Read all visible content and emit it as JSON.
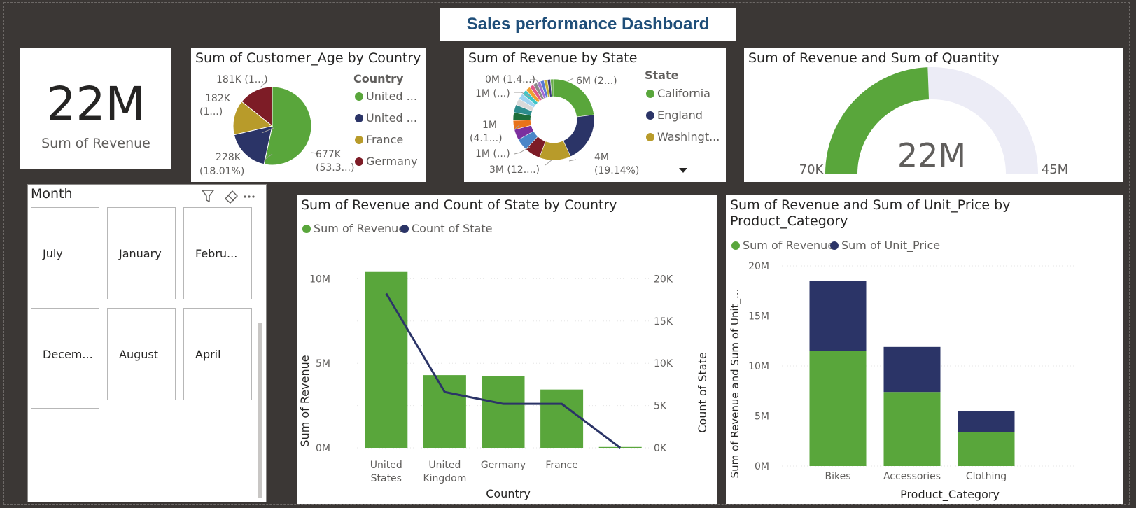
{
  "dashboard": {
    "title": "Sales performance Dashboard"
  },
  "colors": {
    "green": "#59a63b",
    "navy": "#2b3467",
    "gold": "#b89b2a",
    "maroon": "#7d1c26",
    "lavender": "#ececf6"
  },
  "kpi": {
    "value": "22M",
    "label": "Sum of Revenue"
  },
  "age_pie": {
    "title": "Sum of Customer_Age by Country",
    "legend_title": "Country",
    "legend": [
      {
        "label": "United ...",
        "color": "#59a63b"
      },
      {
        "label": "United ...",
        "color": "#2b3467"
      },
      {
        "label": "France",
        "color": "#b89b2a"
      },
      {
        "label": "Germany",
        "color": "#7d1c26"
      }
    ],
    "labels": {
      "green_a": "677K",
      "green_b": "(53.3...)",
      "navy_a": "228K",
      "navy_b": "(18.01%)",
      "gold_a": "182K",
      "gold_b": "(1...)",
      "maroon_a": "181K (1...)"
    }
  },
  "state_donut": {
    "title": "Sum of Revenue by State",
    "legend_title": "State",
    "legend": [
      {
        "label": "California",
        "color": "#59a63b"
      },
      {
        "label": "England",
        "color": "#2b3467"
      },
      {
        "label": "Washingt...",
        "color": "#b89b2a"
      }
    ],
    "labels": {
      "l1": "0M (1.4...)",
      "l2": "1M (...)",
      "l3a": "1M",
      "l3b": "(4.1...)",
      "l4": "1M (...)",
      "l5": "3M (12....)",
      "r1": "6M (2...)",
      "r2a": "4M",
      "r2b": "(19.14%)"
    },
    "more_icon": "caret-down-icon"
  },
  "gauge": {
    "title": "Sum of Revenue and Sum of Quantity",
    "value_label": "22M",
    "min_label": "70K",
    "max_label": "45M",
    "value": 22000000,
    "min": 70000,
    "max": 45000000
  },
  "slicer": {
    "header": "Month",
    "icons": [
      "filter-icon",
      "eraser-icon",
      "more-options-icon"
    ],
    "tiles": [
      "July",
      "January",
      "Febru...",
      "Decem...",
      "August",
      "April",
      ""
    ]
  },
  "chart_data": [
    {
      "type": "pie",
      "title": "Sum of Customer_Age by Country",
      "categories": [
        "United ...",
        "United ...",
        "France",
        "Germany"
      ],
      "values": [
        677000,
        228000,
        182000,
        181000
      ]
    },
    {
      "type": "pie",
      "title": "Sum of Revenue by State",
      "categories": [
        "California",
        "England",
        "Washingt..."
      ],
      "values": [
        6000000,
        4000000,
        3000000
      ]
    },
    {
      "type": "bar",
      "title": "Sum of Revenue and Count of State by Country",
      "categories": [
        "United States",
        "United Kingdom",
        "Germany",
        "France",
        ""
      ],
      "series": [
        {
          "name": "Sum of Revenue",
          "kind": "bar",
          "axis": "left",
          "color": "#59a63b",
          "values": [
            10400000,
            4300000,
            4250000,
            3450000,
            50000
          ]
        },
        {
          "name": "Count of State",
          "kind": "line",
          "axis": "right",
          "color": "#2b3467",
          "values": [
            18250,
            6600,
            5200,
            5200,
            0
          ]
        }
      ],
      "xlabel": "Country",
      "ylabel": "Sum of Revenue",
      "y2label": "Count of State",
      "ylim": [
        0,
        12500000
      ],
      "y2lim": [
        0,
        25000
      ],
      "yticks": [
        {
          "v": 0,
          "label": "0M"
        },
        {
          "v": 5000000,
          "label": "5M"
        },
        {
          "v": 10000000,
          "label": "10M"
        }
      ],
      "y2ticks": [
        {
          "v": 0,
          "label": "0K"
        },
        {
          "v": 5000,
          "label": "5K"
        },
        {
          "v": 10000,
          "label": "10K"
        },
        {
          "v": 15000,
          "label": "15K"
        },
        {
          "v": 20000,
          "label": "20K"
        }
      ]
    },
    {
      "type": "bar",
      "stacked": true,
      "title": "Sum of Revenue and Sum of Unit_Price by Product_Category",
      "categories": [
        "Bikes",
        "Accessories",
        "Clothing"
      ],
      "series": [
        {
          "name": "Sum of Revenue",
          "color": "#59a63b",
          "values": [
            11500000,
            7400000,
            3400000
          ]
        },
        {
          "name": "Sum of Unit_Price",
          "color": "#2b3467",
          "values": [
            7000000,
            4500000,
            2100000
          ]
        }
      ],
      "xlabel": "Product_Category",
      "ylabel": "Sum of Revenue and Sum of Unit_...",
      "ylim": [
        0,
        20000000
      ],
      "yticks": [
        {
          "v": 0,
          "label": "0M"
        },
        {
          "v": 5000000,
          "label": "5M"
        },
        {
          "v": 10000000,
          "label": "10M"
        },
        {
          "v": 15000000,
          "label": "15M"
        },
        {
          "v": 20000000,
          "label": "20M"
        }
      ]
    }
  ]
}
